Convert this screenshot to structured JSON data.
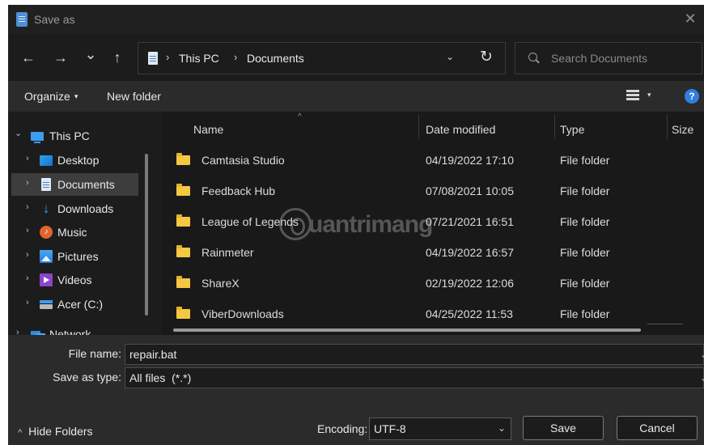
{
  "window": {
    "title": "Save as",
    "close_glyph": "✕"
  },
  "nav": {
    "back_glyph": "←",
    "forward_glyph": "→",
    "recent_glyph": "⌄",
    "up_glyph": "↑",
    "breadcrumb": [
      "This PC",
      "Documents"
    ],
    "separator": "›",
    "dropdown_glyph": "⌄",
    "refresh_glyph": "↻"
  },
  "search": {
    "placeholder": "Search Documents"
  },
  "toolbar": {
    "organize_label": "Organize",
    "organize_caret": "▾",
    "new_folder_label": "New folder",
    "view_caret": "▾",
    "help_glyph": "?"
  },
  "sidebar": {
    "items": [
      {
        "label": "This PC",
        "chevron": "⌄",
        "icon": "monitor-icon"
      },
      {
        "label": "Desktop",
        "chevron": "›",
        "icon": "desktop-icon"
      },
      {
        "label": "Documents",
        "chevron": "›",
        "icon": "documents-icon"
      },
      {
        "label": "Downloads",
        "chevron": "›",
        "icon": "download-icon"
      },
      {
        "label": "Music",
        "chevron": "›",
        "icon": "music-icon"
      },
      {
        "label": "Pictures",
        "chevron": "›",
        "icon": "pictures-icon"
      },
      {
        "label": "Videos",
        "chevron": "›",
        "icon": "videos-icon"
      },
      {
        "label": "Acer (C:)",
        "chevron": "›",
        "icon": "drive-icon"
      },
      {
        "label": "Network",
        "chevron": "›",
        "icon": "network-icon"
      }
    ]
  },
  "filelist": {
    "columns": {
      "name": "Name",
      "date": "Date modified",
      "type": "Type",
      "size": "Size"
    },
    "sort_glyph": "^",
    "rows": [
      {
        "name": "Camtasia Studio",
        "date": "04/19/2022 17:10",
        "type": "File folder"
      },
      {
        "name": "Feedback Hub",
        "date": "07/08/2021 10:05",
        "type": "File folder"
      },
      {
        "name": "League of Legends",
        "date": "07/21/2021 16:51",
        "type": "File folder"
      },
      {
        "name": "Rainmeter",
        "date": "04/19/2022 16:57",
        "type": "File folder"
      },
      {
        "name": "ShareX",
        "date": "02/19/2022 12:06",
        "type": "File folder"
      },
      {
        "name": "ViberDownloads",
        "date": "04/25/2022 11:53",
        "type": "File folder"
      }
    ]
  },
  "watermark": {
    "text": "uantrimang"
  },
  "form": {
    "file_name_label": "File name:",
    "file_name_value": "repair.bat",
    "save_type_label": "Save as type:",
    "save_type_value": "All files  (*.*)",
    "dropdown_glyph": "⌄",
    "hide_folders_glyph": "^",
    "hide_folders_label": "Hide Folders",
    "encoding_label": "Encoding:",
    "encoding_value": "UTF-8",
    "save_label": "Save",
    "cancel_label": "Cancel"
  }
}
